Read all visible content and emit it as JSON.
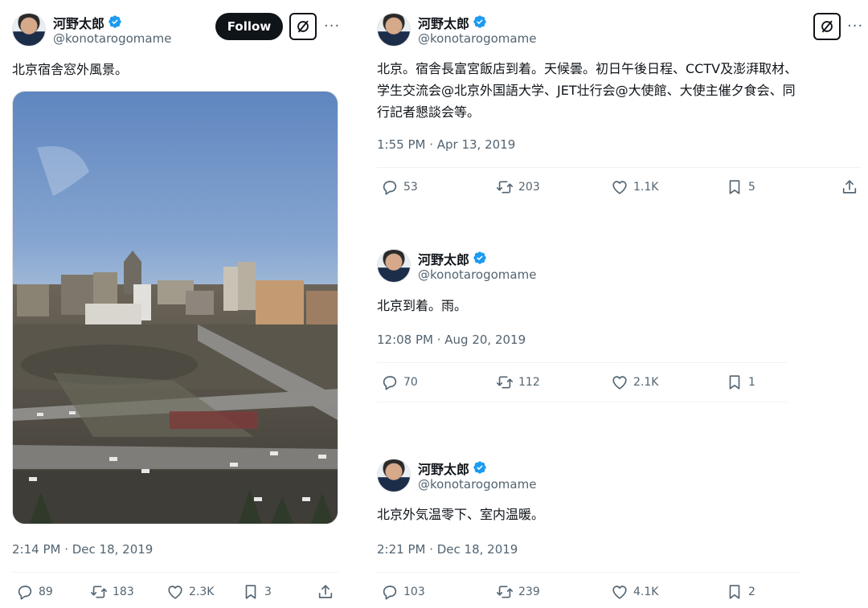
{
  "tweets": [
    {
      "name": "河野太郎",
      "handle": "@konotarogomame",
      "text": "北京宿舎窓外風景。",
      "time": "2:14 PM · Dec 18, 2019",
      "follow_label": "Follow",
      "replies": "89",
      "retweets": "183",
      "likes": "2.3K",
      "bookmarks": "3"
    },
    {
      "name": "河野太郎",
      "handle": "@konotarogomame",
      "text_lines": [
        "北京。宿舎長富宮飯店到着。天候曇。初日午後日程、CCTV及澎湃取材、",
        "学生交流会@北京外国語大学、JET壮行会@大使館、大使主催夕食会、同",
        "行記者懇談会等。"
      ],
      "time": "1:55 PM · Apr 13, 2019",
      "replies": "53",
      "retweets": "203",
      "likes": "1.1K",
      "bookmarks": "5"
    },
    {
      "name": "河野太郎",
      "handle": "@konotarogomame",
      "text": "北京到着。雨。",
      "time": "12:08 PM · Aug 20, 2019",
      "replies": "70",
      "retweets": "112",
      "likes": "2.1K",
      "bookmarks": "1"
    },
    {
      "name": "河野太郎",
      "handle": "@konotarogomame",
      "text": "北京外気温零下、室内温暖。",
      "time": "2:21 PM · Dec 18, 2019",
      "replies": "103",
      "retweets": "239",
      "likes": "4.1K",
      "bookmarks": "2"
    }
  ],
  "more_label": "···",
  "colors": {
    "verified": "#1d9bf0",
    "secondary_text": "#536471",
    "follow_bg": "#0f1419"
  }
}
